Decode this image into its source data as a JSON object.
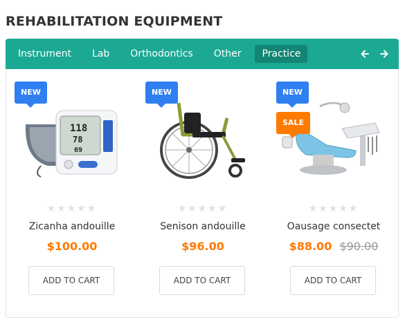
{
  "section": {
    "title": "REHABILITATION EQUIPMENT"
  },
  "tabs": [
    {
      "label": "Instrument",
      "active": false
    },
    {
      "label": "Lab",
      "active": false
    },
    {
      "label": "Orthodontics",
      "active": false
    },
    {
      "label": "Other",
      "active": false
    },
    {
      "label": "Practice",
      "active": true
    }
  ],
  "nav": {
    "prev_icon": "arrow-left-icon",
    "next_icon": "arrow-right-icon"
  },
  "colors": {
    "accent": "#1ba994",
    "accent_dark": "#138574",
    "price": "#ff7a00",
    "new_badge": "#2f7ff0",
    "sale_badge": "#ff7a00"
  },
  "products": [
    {
      "name": "Zicanha andouille",
      "price": "$100.00",
      "old_price": "",
      "badges": [
        "NEW"
      ],
      "rating": 0,
      "stars": "★★★★★",
      "image": "blood-pressure-monitor",
      "cart_label": "ADD TO CART"
    },
    {
      "name": "Senison andouille",
      "price": "$96.00",
      "old_price": "",
      "badges": [
        "NEW"
      ],
      "rating": 0,
      "stars": "★★★★★",
      "image": "wheelchair",
      "cart_label": "ADD TO CART"
    },
    {
      "name": "Oausage consectet",
      "price": "$88.00",
      "old_price": "$90.00",
      "badges": [
        "NEW",
        "SALE"
      ],
      "rating": 0,
      "stars": "★★★★★",
      "image": "dental-chair",
      "cart_label": "ADD TO CART"
    }
  ]
}
